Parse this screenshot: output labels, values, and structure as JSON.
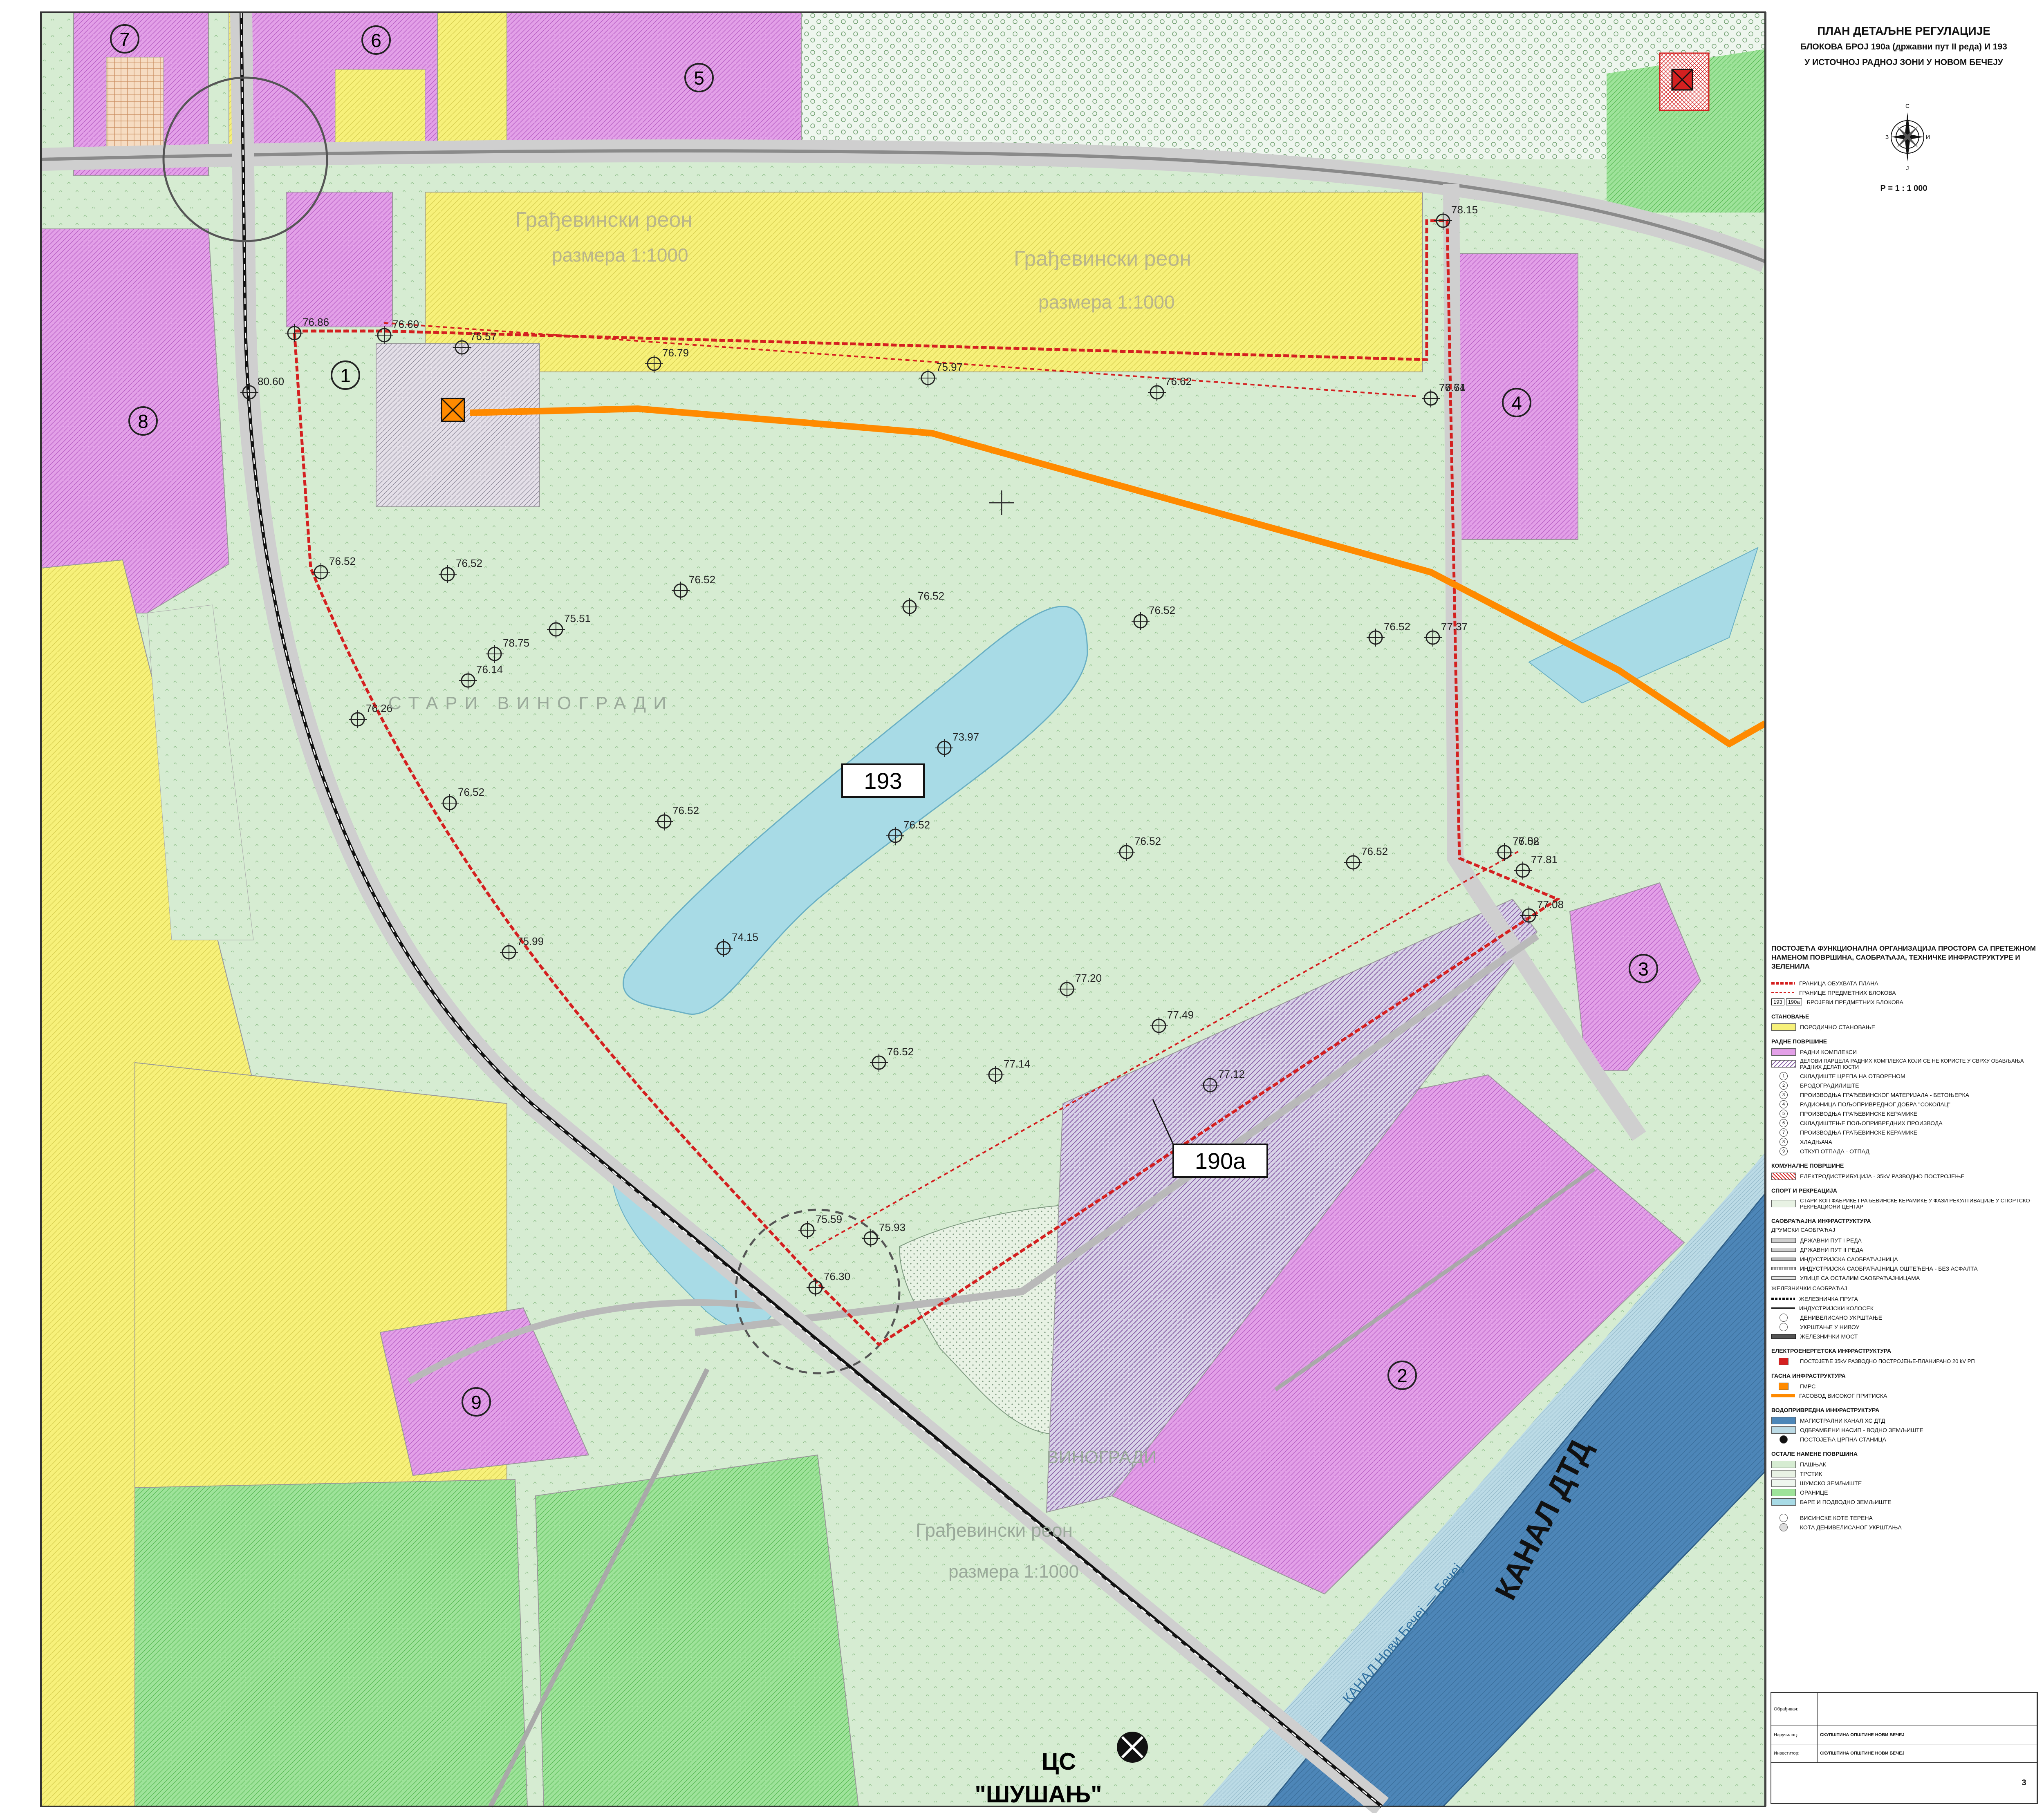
{
  "title": {
    "main": "ПЛАН ДЕТАЉНЕ РЕГУЛАЦИЈЕ",
    "line2": "БЛОКОВА БРОЈ 190а (државни пут II реда) И 193",
    "line3": "У ИСТОЧНОЈ РАДНОЈ ЗОНИ У НОВОМ БЕЧЕЈУ"
  },
  "compass": {
    "north": "С",
    "south": "Ј",
    "east": "И",
    "west": "З"
  },
  "scale": "Р = 1 : 1 000",
  "map": {
    "block_labels": [
      "193",
      "190а"
    ],
    "area_labels": [
      "Грађевински реон",
      "размера 1:1000",
      "СТАРИ ВИНОГРАДИ",
      "ВИНОГРАДИ"
    ],
    "canal_label": "КАНАЛ ДТД",
    "canal_small_label": "КАНАЛ Нови Бечеј — Бечеј",
    "pump_station": [
      "ЦС",
      "\"ШУШАЊ\""
    ],
    "complex_numbers": [
      "1",
      "2",
      "3",
      "4",
      "5",
      "6",
      "7",
      "8",
      "9"
    ],
    "elevations": [
      "76.86",
      "76.60",
      "76.57",
      "76.79",
      "75.97",
      "76.62",
      "76.61",
      "77.74",
      "78.15",
      "80.60",
      "76.52",
      "76.52",
      "76.52",
      "76.52",
      "75.51",
      "78.75",
      "76.14",
      "76.52",
      "76.52",
      "76.26",
      "73.97",
      "76.52",
      "76.52",
      "76.52",
      "76.52",
      "76.52",
      "77.08",
      "77.81",
      "77.08",
      "74.15",
      "77.20",
      "77.49",
      "76.52",
      "77.14",
      "77.12",
      "75.99",
      "75.59",
      "75.93",
      "76.30",
      "76.52",
      "77.37"
    ]
  },
  "legend": {
    "heading": "ПОСТОЈЕЋА ФУНКЦИОНАЛНА ОРГАНИЗАЦИЈА ПРОСТОРА СА ПРЕТЕЖНОМ НАМЕНОМ ПОВРШИНА, САОБРАЋАЈА, ТЕХНИЧКЕ ИНФРАСТРУКТУРЕ И ЗЕЛЕНИЛА",
    "boundaries": [
      "ГРАНИЦА ОБУХВАТА ПЛАНА",
      "ГРАНИЦЕ ПРЕДМЕТНИХ БЛОКОВА"
    ],
    "block_numbers_label": "БРОЈЕВИ ПРЕДМЕТНИХ БЛОКОВА",
    "housing_head": "СТАНОВАЊЕ",
    "housing": "ПОРОДИЧНО СТАНОВАЊЕ",
    "work_head": "РАДНЕ ПОВРШИНЕ",
    "work_items": [
      "РАДНИ КОМПЛЕКСИ",
      "ДЕЛОВИ ПАРЦЕЛА РАДНИХ КОМПЛЕКСА КОЈИ СЕ НЕ КОРИСТЕ У СВРХУ ОБАВЉАЊА РАДНИХ ДЕЛАТНОСТИ"
    ],
    "complexes": [
      "СКЛАДИШТЕ ЦРЕПА НА ОТВОРЕНОМ",
      "БРОДОГРАДИЛИШТЕ",
      "ПРОИЗВОДЊА ГРАЂЕВИНСКОГ МАТЕРИЈАЛА - БЕТОЊЕРКА",
      "РАДИОНИЦА ПОЉОПРИВРЕДНОГ ДОБРА \"СОКОЛАЦ\"",
      "ПРОИЗВОДЊА ГРАЂЕВИНСКЕ КЕРАМИКЕ",
      "СКЛАДИШТЕЊЕ ПОЉОПРИВРЕДНИХ ПРОИЗВОДА",
      "ПРОИЗВОДЊА ГРАЂЕВИНСКЕ КЕРАМИКЕ",
      "ХЛАДЊАЧА",
      "ОТКУП ОТПАДА - ОТПАД"
    ],
    "communal_head": "КОМУНАЛНЕ ПОВРШИНЕ",
    "communal": "ЕЛЕКТРОДИСТРИБУЦИЈА - 35kV РАЗВОДНО ПОСТРОЈЕЊЕ",
    "sport_head": "СПОРТ И РЕКРЕАЦИЈА",
    "sport": "СТАРИ КОП ФАБРИКЕ ГРАЂЕВИНСКЕ КЕРАМИКЕ У ФАЗИ РЕКУЛТИВАЦИЈЕ У СПОРТСКО-РЕКРЕАЦИОНИ ЦЕНТАР",
    "traffic_head": "САОБРАЋАЈНА ИНФРАСТРУКТУРА",
    "road_head": "ДРУМСКИ САОБРАЋАЈ",
    "roads": [
      "ДРЖАВНИ ПУТ I РЕДА",
      "ДРЖАВНИ ПУТ II РЕДА",
      "ИНДУСТРИЈСКА САОБРАЋАЈНИЦА",
      "ИНДУСТРИЈСКА САОБРАЋАЈНИЦА ОШТЕЋЕНА - БЕЗ АСФАЛТА",
      "УЛИЦЕ СА ОСТАЛИМ САОБРАЋАЈНИЦАМА"
    ],
    "rail_head": "ЖЕЛЕЗНИЧКИ САОБРАЋАЈ",
    "rail": [
      "ЖЕЛЕЗНИЧКА ПРУГА",
      "ИНДУСТРИЈСКИ КОЛОСЕК",
      "ДЕНИВЕЛИСАНО УКРШТАЊЕ",
      "УКРШТАЊЕ У НИВОУ",
      "ЖЕЛЕЗНИЧКИ МОСТ"
    ],
    "electro_head": "ЕЛЕКТРОЕНЕРГЕТСКА ИНФРАСТРУКТУРА",
    "electro": "ПОСТОЈЕЋЕ 35kV РАЗВОДНО ПОСТРОЈЕЊЕ-ПЛАНИРАНО 20 kV РП",
    "gas_head": "ГАСНА ИНФРАСТРУКТУРА",
    "gas": [
      "ГМРС",
      "ГАСОВОД ВИСОКОГ ПРИТИСКА"
    ],
    "water_head": "ВОДОПРИВРЕДНА ИНФРАСТРУКТУРА",
    "water": [
      "МАГИСТРАЛНИ КАНАЛ ХС ДТД",
      "ОДБРАМБЕНИ НАСИП - ВОДНО ЗЕМЉИШТЕ",
      "ПОСТОЈЕЋА ЦРПНА СТАНИЦА"
    ],
    "other_head": "ОСТАЛЕ НАМЕНЕ ПОВРШИНА",
    "other": [
      "ПАШЊАК",
      "ТРСТИК",
      "ШУМСКО ЗЕМЉИШТЕ",
      "ОРАНИЦЕ",
      "БАРЕ И ПОДВОДНО ЗЕМЉИШТЕ"
    ],
    "elev": [
      "ВИСИНСКЕ КОТЕ ТЕРЕНА",
      "КОТА ДЕНИВЕЛИСАНОГ УКРШТАЊА"
    ]
  },
  "titleplate": {
    "maker_label": "Обрађивач:",
    "client_label": "Наручилац:",
    "investor_label": "Инвеститор:",
    "client": "СКУПШТИНА ОПШТИНЕ НОВИ БЕЧЕЈ",
    "investor": "СКУПШТИНА ОПШТИНЕ НОВИ БЕЧЕЈ",
    "sheet": "3"
  },
  "colors": {
    "housing": "#f7f17a",
    "work": "#e3a0e8",
    "pasture": "#d6ecd2",
    "arable": "#9ee39a",
    "water": "#a8dbe6",
    "canal": "#4d86b8",
    "boundary": "#d42020",
    "gas": "#ff8a00"
  }
}
